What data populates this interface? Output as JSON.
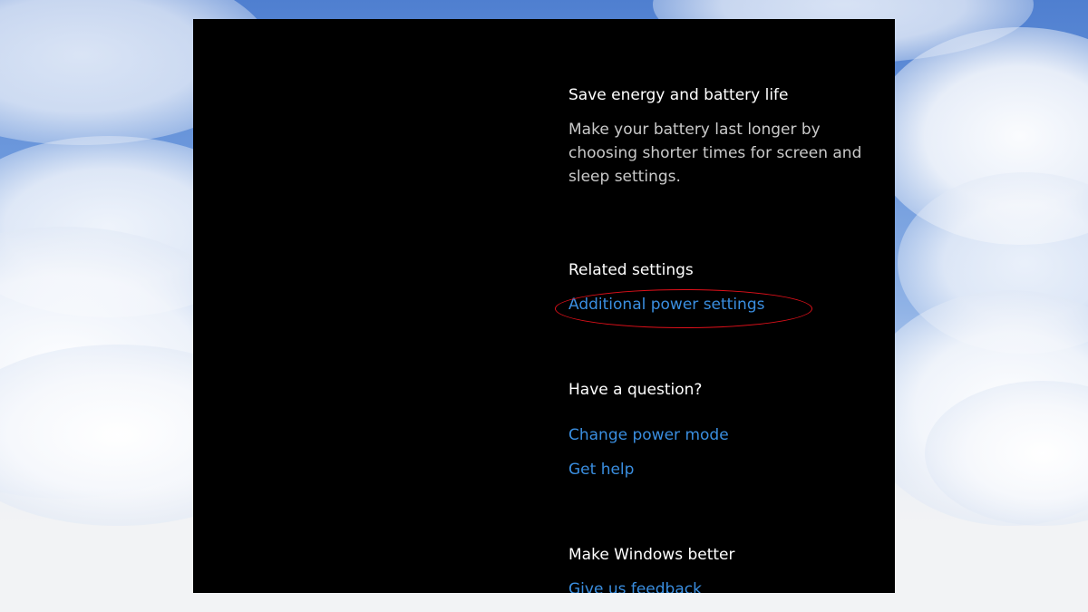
{
  "sections": {
    "save_energy": {
      "heading": "Save energy and battery life",
      "description": "Make your battery last longer by choosing shorter times for screen and sleep settings."
    },
    "related_settings": {
      "heading": "Related settings",
      "links": [
        "Additional power settings"
      ]
    },
    "question": {
      "heading": "Have a question?",
      "links": [
        "Change power mode",
        "Get help"
      ]
    },
    "feedback": {
      "heading": "Make Windows better",
      "links": [
        "Give us feedback"
      ]
    }
  },
  "highlight": {
    "target": "Additional power settings",
    "color": "#e0101a"
  },
  "colors": {
    "panel_background": "#000000",
    "heading_text": "#ffffff",
    "description_text": "#c9c9c9",
    "link_text": "#3a8ee0"
  }
}
